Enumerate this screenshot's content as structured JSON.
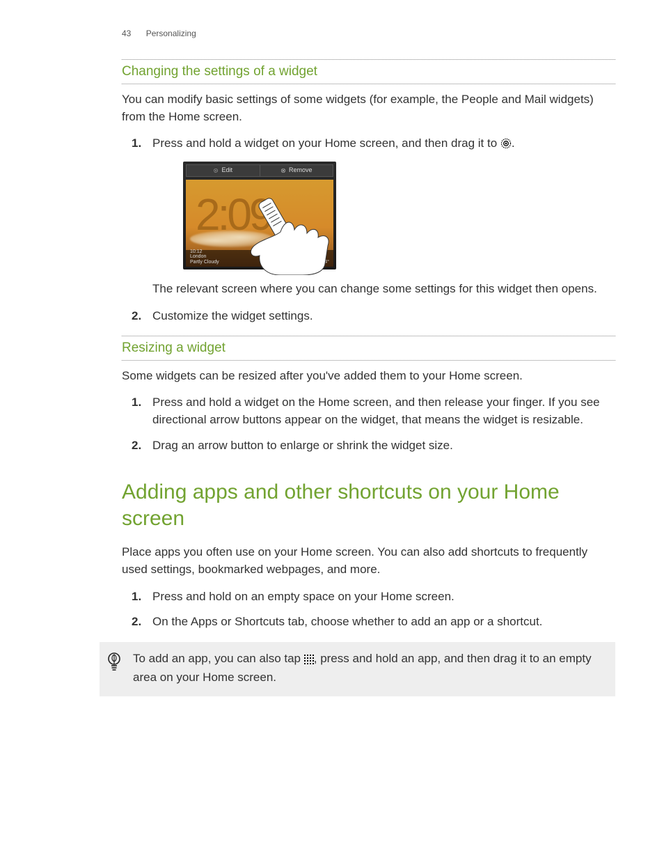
{
  "header": {
    "page_number": "43",
    "section": "Personalizing"
  },
  "s1": {
    "heading": "Changing the settings of a widget",
    "intro": "You can modify basic settings of some widgets (for example, the People and Mail widgets) from the Home screen.",
    "step1_pre": "Press and hold a widget on your Home screen, and then drag it to ",
    "step1_post": ".",
    "after_image": "The relevant screen where you can change some settings for this widget then opens.",
    "step2": "Customize the widget settings."
  },
  "illustration": {
    "edit_label": "Edit",
    "remove_label": "Remove",
    "clock_digits": "2:09",
    "weather_time": "10:12",
    "weather_city": "London",
    "weather_cond": "Partly Cloudy",
    "weather_temp": "9° / 4°"
  },
  "s2": {
    "heading": "Resizing a widget",
    "intro": "Some widgets can be resized after you've added them to your Home screen.",
    "step1": "Press and hold a widget on the Home screen, and then release your finger. If you see directional arrow buttons appear on the widget, that means the widget is resizable.",
    "step2": "Drag an arrow button to enlarge or shrink the widget size."
  },
  "s3": {
    "heading": "Adding apps and other shortcuts on your Home screen",
    "intro": "Place apps you often use on your Home screen. You can also add shortcuts to frequently used settings, bookmarked webpages, and more.",
    "step1": "Press and hold on an empty space on your Home screen.",
    "step2": "On the Apps or Shortcuts tab, choose whether to add an app or a shortcut."
  },
  "tip": {
    "pre": "To add an app, you can also tap ",
    "post": ", press and hold an app, and then drag it to an empty area on your Home screen."
  },
  "markers": {
    "m1": "1.",
    "m2": "2."
  }
}
